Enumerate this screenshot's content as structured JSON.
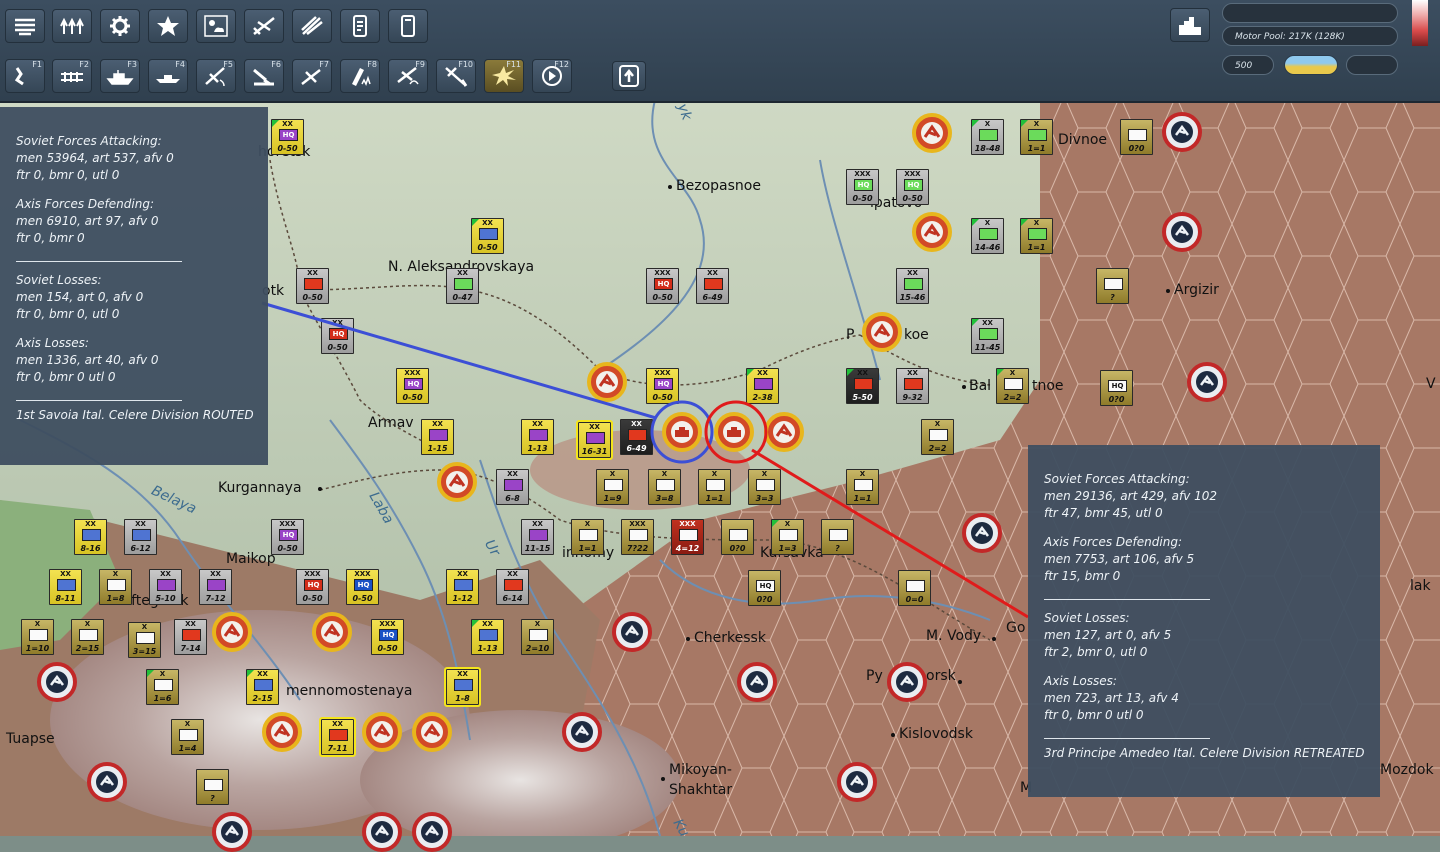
{
  "toolbar": {
    "row1": [
      {
        "icon": "unit-list-icon"
      },
      {
        "icon": "supply-icon"
      },
      {
        "icon": "gear-icon"
      },
      {
        "icon": "star-icon"
      },
      {
        "icon": "weather-icon"
      },
      {
        "icon": "aircraft-icon"
      },
      {
        "icon": "rocket-icon"
      },
      {
        "icon": "report-icon"
      },
      {
        "icon": "notes-icon"
      }
    ],
    "row2": [
      {
        "icon": "road-move-icon",
        "key": "F1"
      },
      {
        "icon": "rail-move-icon",
        "key": "F2"
      },
      {
        "icon": "naval-icon",
        "key": "F3"
      },
      {
        "icon": "transport-ship-icon",
        "key": "F4"
      },
      {
        "icon": "air-recon-icon",
        "key": "F5"
      },
      {
        "icon": "artillery-icon",
        "key": "F6"
      },
      {
        "icon": "air-strike-icon",
        "key": "F7"
      },
      {
        "icon": "ground-attack-icon",
        "key": "F8"
      },
      {
        "icon": "paradrop-icon",
        "key": "F9"
      },
      {
        "icon": "interdict-icon",
        "key": "F10"
      },
      {
        "icon": "combat-icon",
        "key": "F11",
        "active": true
      },
      {
        "icon": "next-icon",
        "key": "F12"
      },
      {
        "icon": "upgrade-icon"
      }
    ],
    "motor_pool": "Motor Pool: 217K (128K)",
    "points_value": "500"
  },
  "panel_left": {
    "attack_header": "Soviet Forces Attacking:",
    "attack_l1": "men 53964, art 537, afv 0",
    "attack_l2": "ftr 0, bmr 0, utl 0",
    "defend_header": "Axis Forces Defending:",
    "defend_l1": "men 6910, art 97, afv 0",
    "defend_l2": "ftr 0, bmr 0",
    "att_loss_header": "Soviet Losses:",
    "att_loss_l1": "men 154, art 0, afv 0",
    "att_loss_l2": "ftr 0, bmr 0, utl 0",
    "def_loss_header": "Axis Losses:",
    "def_loss_l1": "men 1336, art 40, afv 0",
    "def_loss_l2": "ftr 0, bmr 0 utl 0",
    "result": "1st Savoia Ital. Celere Division ROUTED"
  },
  "panel_right": {
    "attack_header": "Soviet Forces Attacking:",
    "attack_l1": "men 29136, art 429, afv 102",
    "attack_l2": "ftr 47, bmr 45, utl 0",
    "defend_header": "Axis Forces Defending:",
    "defend_l1": "men 7753, art 106, afv 5",
    "defend_l2": "ftr 15, bmr 0",
    "att_loss_header": "Soviet Losses:",
    "att_loss_l1": "men 127, art 0, afv 5",
    "att_loss_l2": "ftr 2, bmr 0, utl 0",
    "def_loss_header": "Axis Losses:",
    "def_loss_l1": "men 723, art 13, afv 4",
    "def_loss_l2": "ftr 0, bmr 0 utl 0",
    "result": "3rd Principe Amedeo Ital. Celere Division RETREATED"
  },
  "cities": [
    {
      "name": "horetsk"
    },
    {
      "name": "Bezopasnoe"
    },
    {
      "name": "N. Aleksandrovskaya"
    },
    {
      "name": "otk"
    },
    {
      "name": "ipatovo"
    },
    {
      "name": "Divnoe"
    },
    {
      "name": "Argizir"
    },
    {
      "name": "P"
    },
    {
      "name": "koe"
    },
    {
      "name": "Bal"
    },
    {
      "name": "tnoe"
    },
    {
      "name": "Armav"
    },
    {
      "name": "Kurgannaya"
    },
    {
      "name": "Maikop"
    },
    {
      "name": "Neftegorsk"
    },
    {
      "name": "innomy"
    },
    {
      "name": "Kursavka"
    },
    {
      "name": "Cherkessk"
    },
    {
      "name": "M. Vody"
    },
    {
      "name": "Go"
    },
    {
      "name": "Py"
    },
    {
      "name": "orsk"
    },
    {
      "name": "Kislovodsk"
    },
    {
      "name": "mennomostenaya"
    },
    {
      "name": "Tuapse"
    },
    {
      "name": "Mikoyan-"
    },
    {
      "name": "Shakhtar"
    },
    {
      "name": "lak"
    },
    {
      "name": "Mozdok"
    },
    {
      "name": "M"
    },
    {
      "name": "V"
    }
  ],
  "rivers": [
    {
      "name": "Belaya"
    },
    {
      "name": "Laba"
    },
    {
      "name": "Ur"
    },
    {
      "name": "Ku"
    },
    {
      "name": "yk"
    }
  ],
  "units": [
    {
      "size": "XX",
      "value": "0-50",
      "sym": "HQ"
    },
    {
      "size": "XXX",
      "value": "0-50",
      "sym": "HQ"
    },
    {
      "size": "XXX",
      "value": "0-50",
      "sym": "HQ"
    },
    {
      "size": "X",
      "value": "18-48",
      "sym": ""
    },
    {
      "size": "X",
      "value": "1=1",
      "sym": ""
    },
    {
      "size": "",
      "value": "0?0",
      "sym": ""
    },
    {
      "size": "XX",
      "value": "0-50",
      "sym": ""
    },
    {
      "size": "XX",
      "value": "0-47",
      "sym": ""
    },
    {
      "size": "XXX",
      "value": "0-50",
      "sym": "HQ"
    },
    {
      "size": "XX",
      "value": "6-49",
      "sym": ""
    },
    {
      "size": "X",
      "value": "14-46",
      "sym": ""
    },
    {
      "size": "X",
      "value": "1=1",
      "sym": ""
    },
    {
      "size": "XX",
      "value": "15-46",
      "sym": ""
    },
    {
      "size": "",
      "value": "?",
      "sym": ""
    },
    {
      "size": "XX",
      "value": "0-50",
      "sym": ""
    },
    {
      "size": "XX",
      "value": "0-50",
      "sym": "HQ"
    },
    {
      "size": "XX",
      "value": "11-45",
      "sym": ""
    },
    {
      "size": "XXX",
      "value": "0-50",
      "sym": "HQ"
    },
    {
      "size": "XXX",
      "value": "0-50",
      "sym": "HQ"
    },
    {
      "size": "XX",
      "value": "2-38",
      "sym": ""
    },
    {
      "size": "XX",
      "value": "5-50",
      "sym": ""
    },
    {
      "size": "XX",
      "value": "9-32",
      "sym": ""
    },
    {
      "size": "X",
      "value": "2=2",
      "sym": ""
    },
    {
      "size": "",
      "value": "0?0",
      "sym": "HQ"
    },
    {
      "size": "XX",
      "value": "1-15",
      "sym": ""
    },
    {
      "size": "XX",
      "value": "1-13",
      "sym": ""
    },
    {
      "size": "XX",
      "value": "16-31",
      "sym": ""
    },
    {
      "size": "XX",
      "value": "6-49",
      "sym": ""
    },
    {
      "size": "X",
      "value": "2=2",
      "sym": ""
    },
    {
      "size": "XX",
      "value": "6-8",
      "sym": ""
    },
    {
      "size": "X",
      "value": "1=9",
      "sym": ""
    },
    {
      "size": "X",
      "value": "3=8",
      "sym": ""
    },
    {
      "size": "X",
      "value": "1=1",
      "sym": ""
    },
    {
      "size": "X",
      "value": "3=3",
      "sym": ""
    },
    {
      "size": "X",
      "value": "1=1",
      "sym": ""
    },
    {
      "size": "XX",
      "value": "8-16",
      "sym": ""
    },
    {
      "size": "XX",
      "value": "6-12",
      "sym": ""
    },
    {
      "size": "XXX",
      "value": "0-50",
      "sym": "HQ"
    },
    {
      "size": "XX",
      "value": "11-15",
      "sym": ""
    },
    {
      "size": "X",
      "value": "1=1",
      "sym": ""
    },
    {
      "size": "XXX",
      "value": "7?22",
      "sym": ""
    },
    {
      "size": "XXX",
      "value": "4=12",
      "sym": ""
    },
    {
      "size": "",
      "value": "0?0",
      "sym": ""
    },
    {
      "size": "X",
      "value": "1=3",
      "sym": ""
    },
    {
      "size": "",
      "value": "?",
      "sym": ""
    },
    {
      "size": "XX",
      "value": "8-11",
      "sym": ""
    },
    {
      "size": "X",
      "value": "1=8",
      "sym": ""
    },
    {
      "size": "XX",
      "value": "5-10",
      "sym": ""
    },
    {
      "size": "XX",
      "value": "7-12",
      "sym": ""
    },
    {
      "size": "XXX",
      "value": "0-50",
      "sym": "HQ"
    },
    {
      "size": "XXX",
      "value": "0-50",
      "sym": "HQ"
    },
    {
      "size": "XX",
      "value": "1-12",
      "sym": ""
    },
    {
      "size": "XX",
      "value": "6-14",
      "sym": ""
    },
    {
      "size": "",
      "value": "0?0",
      "sym": "HQ"
    },
    {
      "size": "",
      "value": "0=0",
      "sym": ""
    },
    {
      "size": "X",
      "value": "1=10",
      "sym": ""
    },
    {
      "size": "X",
      "value": "2=15",
      "sym": ""
    },
    {
      "size": "X",
      "value": "3=15",
      "sym": ""
    },
    {
      "size": "XX",
      "value": "7-14",
      "sym": ""
    },
    {
      "size": "XXX",
      "value": "0-50",
      "sym": "HQ"
    },
    {
      "size": "XX",
      "value": "1-13",
      "sym": ""
    },
    {
      "size": "X",
      "value": "2=10",
      "sym": ""
    },
    {
      "size": "X",
      "value": "1=6",
      "sym": ""
    },
    {
      "size": "XX",
      "value": "2-15",
      "sym": ""
    },
    {
      "size": "XX",
      "value": "1-8",
      "sym": ""
    },
    {
      "size": "X",
      "value": "1=4",
      "sym": ""
    },
    {
      "size": "XX",
      "value": "7-11",
      "sym": ""
    },
    {
      "size": "",
      "value": "?",
      "sym": ""
    }
  ],
  "colors": {
    "toolbar_bg": "#34465a",
    "panel_bg": "#3e4e60",
    "axis_air": "#d24a27",
    "soviet_air": "#c22828",
    "attack_line_left": "#3c4fd6",
    "attack_line_right": "#e01b1b"
  }
}
